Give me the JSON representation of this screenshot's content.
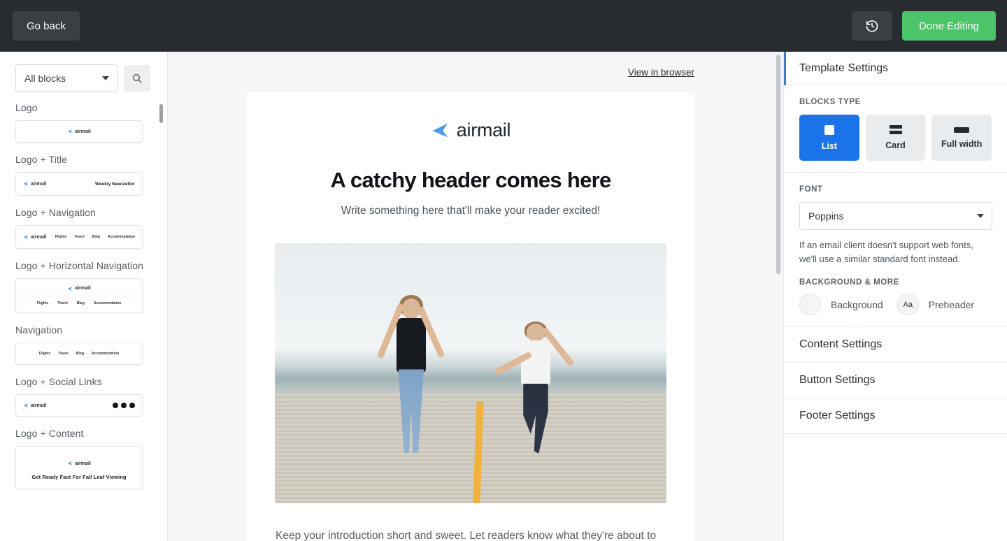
{
  "topbar": {
    "go_back_label": "Go back",
    "history_icon": "history-revert-icon",
    "done_label": "Done Editing",
    "accent_green": "#4bc46a",
    "background": "#282c31"
  },
  "sidebar": {
    "filter_value": "All blocks",
    "search_icon": "search-icon",
    "blocks": [
      {
        "label": "Logo",
        "preview": "logo"
      },
      {
        "label": "Logo + Title",
        "preview": "logo_title",
        "title": "Weekly Newsletter"
      },
      {
        "label": "Logo + Navigation",
        "preview": "logo_nav"
      },
      {
        "label": "Logo + Horizontal Navigation",
        "preview": "logo_hnav"
      },
      {
        "label": "Navigation",
        "preview": "nav"
      },
      {
        "label": "Logo + Social Links",
        "preview": "logo_social"
      },
      {
        "label": "Logo + Content",
        "preview": "logo_content",
        "headline": "Get Ready Fast For Fall Leaf Viewing"
      }
    ],
    "nav_items": [
      "Flights",
      "Travel",
      "Blog",
      "Accommodation"
    ],
    "brand": "airmail",
    "social_icons": [
      "facebook-icon",
      "twitter-icon",
      "instagram-icon"
    ]
  },
  "canvas": {
    "view_in_browser": "View in browser",
    "brand": "airmail",
    "headline": "A catchy header comes here",
    "subheading": "Write something here that'll make your reader excited!",
    "image_alt": "two-women-jumping-on-beach-boardwalk",
    "paragraph": "Keep your introduction short and sweet. Let readers know what they're about to",
    "background": "#f4f6f8"
  },
  "panel": {
    "title": "Template Settings",
    "accent_blue": "#1a73e8",
    "blocks_type_label": "BLOCKS TYPE",
    "blocks_type": [
      {
        "label": "List",
        "icon": "square-icon",
        "active": true
      },
      {
        "label": "Card",
        "icon": "stacked-bars-icon",
        "active": false
      },
      {
        "label": "Full width",
        "icon": "wide-bar-icon",
        "active": false
      }
    ],
    "font_label": "FONT",
    "font_value": "Poppins",
    "font_hint": "If an email client doesn't support web fonts, we'll use a similar standard font instead.",
    "background_more_label": "BACKGROUND & MORE",
    "background_label": "Background",
    "preheader_label": "Preheader",
    "preheader_glyph": "Aa",
    "sections": [
      {
        "label": "Content Settings"
      },
      {
        "label": "Button Settings"
      },
      {
        "label": "Footer Settings"
      }
    ]
  }
}
